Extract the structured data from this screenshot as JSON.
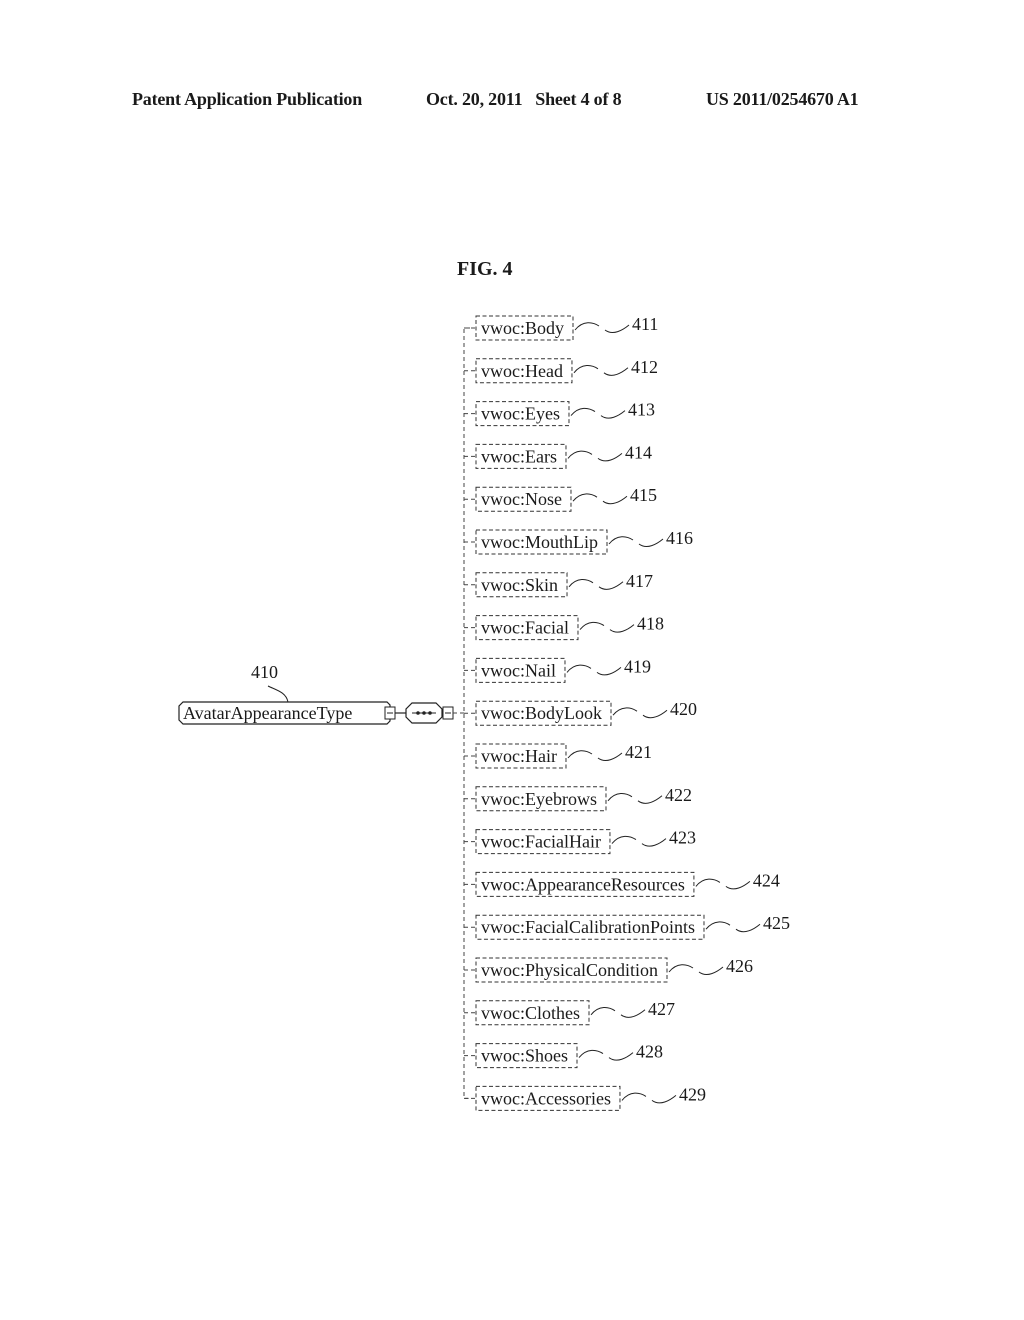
{
  "header": {
    "publication": "Patent Application Publication",
    "date_sheet": "Oct. 20, 2011   Sheet 4 of 8",
    "number": "US 2011/0254670 A1"
  },
  "figure": {
    "title": "FIG. 4",
    "root": {
      "label": "AvatarAppearanceType",
      "ref": "410"
    },
    "children": [
      {
        "label": "vwoc:Body",
        "ref": "411"
      },
      {
        "label": "vwoc:Head",
        "ref": "412"
      },
      {
        "label": "vwoc:Eyes",
        "ref": "413"
      },
      {
        "label": "vwoc:Ears",
        "ref": "414"
      },
      {
        "label": "vwoc:Nose",
        "ref": "415"
      },
      {
        "label": "vwoc:MouthLip",
        "ref": "416"
      },
      {
        "label": "vwoc:Skin",
        "ref": "417"
      },
      {
        "label": "vwoc:Facial",
        "ref": "418"
      },
      {
        "label": "vwoc:Nail",
        "ref": "419"
      },
      {
        "label": "vwoc:BodyLook",
        "ref": "420"
      },
      {
        "label": "vwoc:Hair",
        "ref": "421"
      },
      {
        "label": "vwoc:Eyebrows",
        "ref": "422"
      },
      {
        "label": "vwoc:FacialHair",
        "ref": "423"
      },
      {
        "label": "vwoc:AppearanceResources",
        "ref": "424"
      },
      {
        "label": "vwoc:FacialCalibrationPoints",
        "ref": "425"
      },
      {
        "label": "vwoc:PhysicalCondition",
        "ref": "426"
      },
      {
        "label": "vwoc:Clothes",
        "ref": "427"
      },
      {
        "label": "vwoc:Shoes",
        "ref": "428"
      },
      {
        "label": "vwoc:Accessories",
        "ref": "429"
      }
    ]
  }
}
